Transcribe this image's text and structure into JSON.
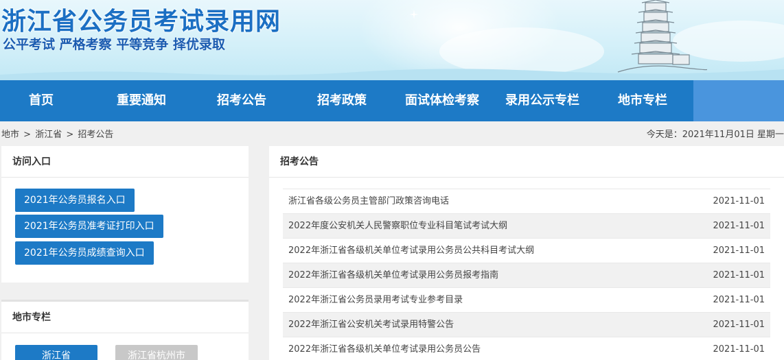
{
  "header": {
    "site_title": "浙江省公务员考试录用网",
    "slogan": "公平考试 严格考察 平等竞争 择优录取"
  },
  "nav": {
    "items": [
      {
        "label": "首页"
      },
      {
        "label": "重要通知"
      },
      {
        "label": "招考公告"
      },
      {
        "label": "招考政策"
      },
      {
        "label": "面试体检考察"
      },
      {
        "label": "录用公示专栏"
      },
      {
        "label": "地市专栏"
      }
    ]
  },
  "breadcrumb": {
    "items": [
      "地市",
      ">",
      "浙江省",
      " >",
      "招考公告"
    ]
  },
  "today": "今天是：2021年11月01日 星期一",
  "entry_panel": {
    "title": "访问入口",
    "buttons": [
      {
        "label": "2021年公务员报名入口"
      },
      {
        "label": "2021年公务员准考证打印入口"
      },
      {
        "label": "2021年公务员成绩查询入口"
      }
    ]
  },
  "city_panel": {
    "title": "地市专栏",
    "buttons": [
      {
        "label": "浙江省",
        "active": true
      },
      {
        "label": "浙江省杭州市",
        "active": false
      }
    ]
  },
  "notice_panel": {
    "title": "招考公告",
    "rows": [
      {
        "title": "浙江省各级公务员主管部门政策咨询电话",
        "date": "2021-11-01"
      },
      {
        "title": "2022年度公安机关人民警察职位专业科目笔试考试大纲",
        "date": "2021-11-01"
      },
      {
        "title": "2022年浙江省各级机关单位考试录用公务员公共科目考试大纲",
        "date": "2021-11-01"
      },
      {
        "title": "2022年浙江省各级机关单位考试录用公务员报考指南",
        "date": "2021-11-01"
      },
      {
        "title": "2022年浙江省公务员录用考试专业参考目录",
        "date": "2021-11-01"
      },
      {
        "title": "2022年浙江省公安机关考试录用特警公告",
        "date": "2021-11-01"
      },
      {
        "title": "2022年浙江省各级机关单位考试录用公务员公告",
        "date": "2021-11-01"
      }
    ]
  },
  "colors": {
    "nav_bg": "#1d7ac6",
    "nav_extra": "#4a95dd",
    "button_bg": "#1d7ac6",
    "button_disabled": "#c8c8c8",
    "title_blue": "#1b6fc3"
  }
}
